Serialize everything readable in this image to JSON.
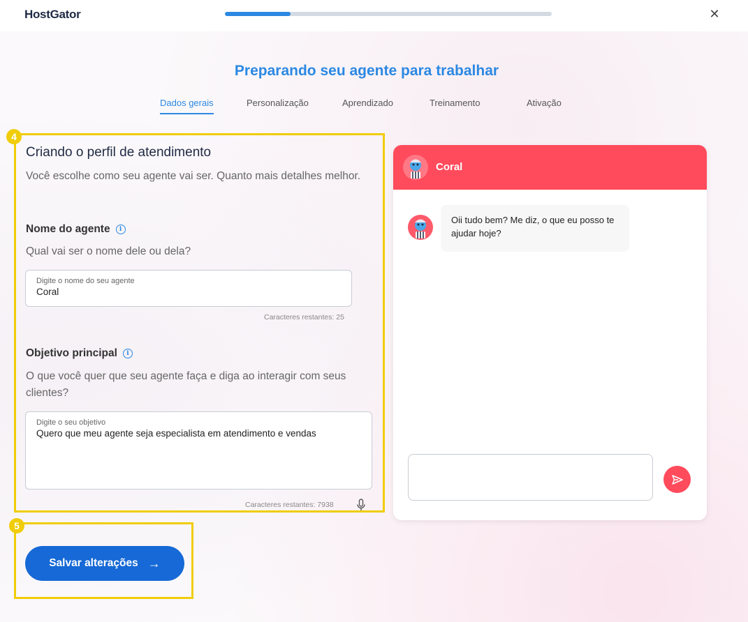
{
  "topbar": {
    "logo": "HostGator",
    "progress_percent": 20,
    "close_symbol": "✕"
  },
  "page": {
    "heading": "Preparando seu agente para trabalhar",
    "tabs": [
      {
        "label": "Dados gerais",
        "active": true
      },
      {
        "label": "Personalização",
        "active": false
      },
      {
        "label": "Aprendizado",
        "active": false
      },
      {
        "label": "Treinamento",
        "active": false
      },
      {
        "label": "Ativação",
        "active": false
      }
    ]
  },
  "highlights": {
    "form_badge": "4",
    "save_badge": "5",
    "color": "#f0cd0a"
  },
  "form": {
    "title": "Criando o perfil de atendimento",
    "description": "Você escolhe como seu agente vai ser. Quanto mais detalhes melhor.",
    "agent_name": {
      "label": "Nome do agente",
      "question": "Qual vai ser o nome dele ou dela?",
      "field_label": "Digite o nome do seu agente",
      "value": "Coral",
      "counter": "Caracteres restantes: 25"
    },
    "objective": {
      "label": "Objetivo principal",
      "question": "O que você quer que seu agente faça e diga ao interagir com seus clientes?",
      "field_label": "Digite o seu objetivo",
      "value": "Quero que meu agente seja especialista em atendimento e vendas",
      "counter": "Caracteres restantes: 7938"
    },
    "info_symbol": "i",
    "save_label": "Salvar alterações",
    "save_arrow": "→"
  },
  "chat": {
    "agent_name": "Coral",
    "message": "Oii tudo bem? Me diz, o que eu posso te ajudar hoje?",
    "header_color": "#ff4b5c"
  },
  "colors": {
    "accent_blue": "#2b88e3",
    "button_blue": "#1669d6",
    "coral": "#ff4b5c"
  }
}
